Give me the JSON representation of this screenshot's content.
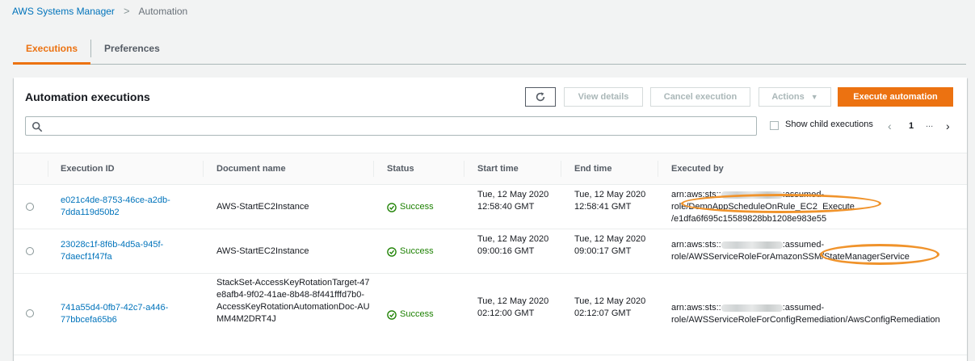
{
  "breadcrumb": {
    "parent": "AWS Systems Manager",
    "separator": ">",
    "current": "Automation"
  },
  "tabs": [
    {
      "label": "Executions",
      "active": true
    },
    {
      "label": "Preferences",
      "active": false
    }
  ],
  "panel": {
    "title": "Automation executions",
    "buttons": {
      "refresh_icon": "refresh-icon",
      "view_details": "View details",
      "cancel_execution": "Cancel execution",
      "actions": "Actions",
      "execute_automation": "Execute automation"
    },
    "search": {
      "placeholder": "",
      "value": ""
    },
    "show_child_executions": "Show child executions",
    "pagination": {
      "current_page": "1",
      "ellipsis": "...",
      "prev": "‹",
      "next": "›"
    }
  },
  "table": {
    "columns": [
      "Execution ID",
      "Document name",
      "Status",
      "Start time",
      "End time",
      "Executed by"
    ],
    "rows": [
      {
        "execution_id": "e021c4de-8753-46ce-a2db-7dda119d50b2",
        "document_name": "AWS-StartEC2Instance",
        "status": "Success",
        "start_time": "Tue, 12 May 2020 12:58:40 GMT",
        "end_time": "Tue, 12 May 2020 12:58:41 GMT",
        "executed_by_line1_prefix": "arn:aws:sts::",
        "executed_by_line1_suffix": ":assumed-",
        "executed_by_line2": "role/DemoAppScheduleOnRule_EC2_Execute",
        "executed_by_line3": "/e1dfa6f695c15589828bb1208e983e55"
      },
      {
        "execution_id": "23028c1f-8f6b-4d5a-945f-7daecf1f47fa",
        "document_name": "AWS-StartEC2Instance",
        "status": "Success",
        "start_time": "Tue, 12 May 2020 09:00:16 GMT",
        "end_time": "Tue, 12 May 2020 09:00:17 GMT",
        "executed_by_line1_prefix": "arn:aws:sts::",
        "executed_by_line1_suffix": ":assumed-",
        "executed_by_line2": "role/AWSServiceRoleForAmazonSSM/StateManagerService"
      },
      {
        "execution_id": "741a55d4-0fb7-42c7-a446-77bbcefa65b6",
        "document_name": "StackSet-AccessKeyRotationTarget-47e8afb4-9f02-41ae-8b48-8f441fffd7b0-AccessKeyRotationAutomationDoc-AUMM4M2DRT4J",
        "status": "Success",
        "start_time": "Tue, 12 May 2020 02:12:00 GMT",
        "end_time": "Tue, 12 May 2020 02:12:07 GMT",
        "executed_by_line1_prefix": "arn:aws:sts::",
        "executed_by_line1_suffix": ":assumed-",
        "executed_by_line2": "role/AWSServiceRoleForConfigRemediation/AwsConfigRemediation"
      }
    ]
  },
  "colors": {
    "accent": "#ec7211",
    "link": "#0073bb",
    "success": "#1d8102",
    "annotation": "#f0932b"
  }
}
